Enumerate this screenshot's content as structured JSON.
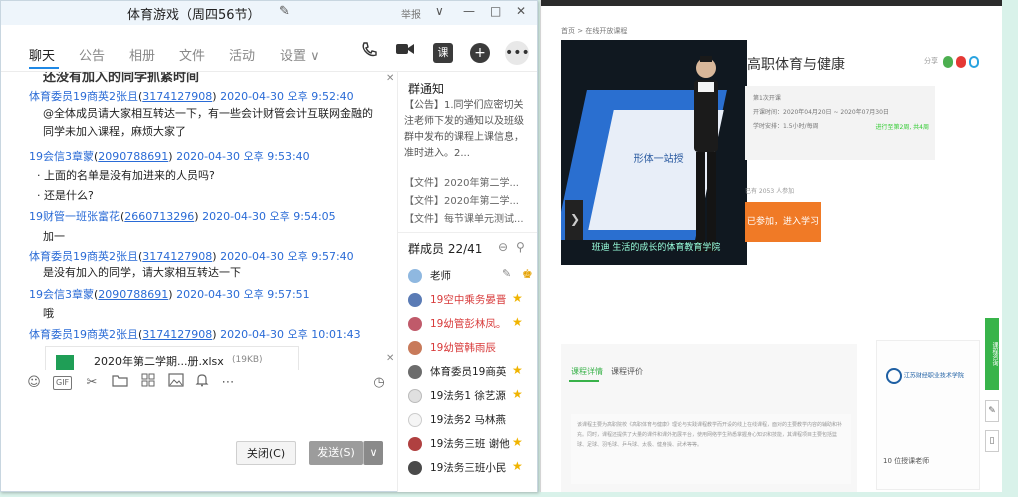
{
  "window": {
    "title": "体育游戏（周四56节）",
    "report": "举报",
    "controls": {
      "collapse": "∨",
      "minimize": "—",
      "maximize": "□",
      "close": "✕"
    }
  },
  "tabs": [
    {
      "label": "聊天",
      "active": true
    },
    {
      "label": "公告"
    },
    {
      "label": "相册"
    },
    {
      "label": "文件"
    },
    {
      "label": "活动"
    },
    {
      "label": "设置 ∨"
    }
  ],
  "header_icons": [
    "phone-icon",
    "video-call-icon",
    "class-icon",
    "add-icon",
    "more-icon"
  ],
  "header_class_label": "课",
  "chat": {
    "partial_top_text": "还没有加入的同学抓紧时间",
    "messages": [
      {
        "sender": "体育委员19商英2张且",
        "qq": "3174127908",
        "time": "2020-04-30 오후 9:52:40",
        "lines": [
          "@全体成员请大家相互转达一下，有一些会计财管会计互联网金融的",
          "同学未加入课程，麻烦大家了"
        ]
      },
      {
        "sender": "19会信3章蒙",
        "qq": "2090788691",
        "time": "2020-04-30 오후 9:53:40",
        "bullets": [
          "上面的名单是没有加进来的人员吗?",
          "还是什么?"
        ]
      },
      {
        "sender": "19财管一班张富花",
        "qq": "2660713296",
        "time": "2020-04-30 오후 9:54:05",
        "lines": [
          "加一"
        ]
      },
      {
        "sender": "体育委员19商英2张且",
        "qq": "3174127908",
        "time": "2020-04-30 오후 9:57:40",
        "lines": [
          "是没有加入的同学，请大家相互转达一下"
        ]
      },
      {
        "sender": "19会信3章蒙",
        "qq": "2090788691",
        "time": "2020-04-30 오후 9:57:51",
        "lines": [
          "哦"
        ]
      },
      {
        "sender": "体育委员19商英2张且",
        "qq": "3174127908",
        "time": "2020-04-30 오후 10:01:43"
      }
    ],
    "file": {
      "name": "2020年第二学期...册.xlsx",
      "size": "(19KB)"
    }
  },
  "toolbar_icons": [
    "emoji-icon",
    "gif-icon",
    "scissors-icon",
    "folder-icon",
    "sticker-icon",
    "image-icon",
    "bell-icon",
    "more-icon",
    "history-icon"
  ],
  "gif_label": "GIF",
  "buttons": {
    "close": "关闭(C)",
    "send": "发送(S)",
    "send_arrow": "∨"
  },
  "notice": {
    "heading": "群通知",
    "text": "【公告】1.同学们应密切关注老师下发的通知以及班级群中发布的课程上课信息，准时进入。2...",
    "files": [
      "【文件】2020年第二学...",
      "【文件】2020年第二学...",
      "【文件】每节课单元测试..."
    ]
  },
  "members": {
    "heading": "群成员 22/41",
    "list": [
      {
        "name": "老师",
        "color": "#222222",
        "badge": "owner"
      },
      {
        "name": "19空中乘务晏晋",
        "color": "#d83b3b",
        "badge": "star"
      },
      {
        "name": "19幼管彭林凤。",
        "color": "#d83b3b",
        "badge": "star"
      },
      {
        "name": "19幼管韩雨辰",
        "color": "#d83b3b",
        "badge": ""
      },
      {
        "name": "体育委员19商英",
        "color": "#222222",
        "badge": "star"
      },
      {
        "name": "19法务1 徐艺源",
        "color": "#222222",
        "badge": "star"
      },
      {
        "name": "19法务2  马林燕",
        "color": "#222222",
        "badge": ""
      },
      {
        "name": "19法务三班 谢他",
        "color": "#222222",
        "badge": "star"
      },
      {
        "name": "19法务三班小民",
        "color": "#222222",
        "badge": "star"
      }
    ]
  },
  "web": {
    "breadcrumb": "首页 > 在线开放课程",
    "course_title": "高职体育与健康",
    "share": "分享",
    "info_lines": [
      "第1次开课",
      "开课时间：2020年04月20日 ~ 2020年07月30日",
      "学时安排：1.5小时/每周"
    ],
    "info_tag": "进行至第2周, 共4周",
    "enrolled": "已有 2053 人参加",
    "enroll_button": "已参加，进入学习",
    "video_caption": "班迪 生活的成长的体育教育学院",
    "video_slide_title": "形体一站授",
    "tabs": [
      "课程详情",
      "课程评价"
    ],
    "description": "该课程主要为高职院校《高职体育与健康》理论与实践课程教学而开设的线上在线课程，面对的主要教学内容的辅助和补充。同时，课程还提供了大量的课件和课外拓展平台，使用网络学生熟悉掌握身心知识和技能，其课程项目主要包括篮球、足球、羽毛球、乒乓球、太极、健身操、武术等等。",
    "school_logo": "江苏财经职业技术学院",
    "teacher_count": "10 位授课老师",
    "green_bar": "课程咨询"
  }
}
